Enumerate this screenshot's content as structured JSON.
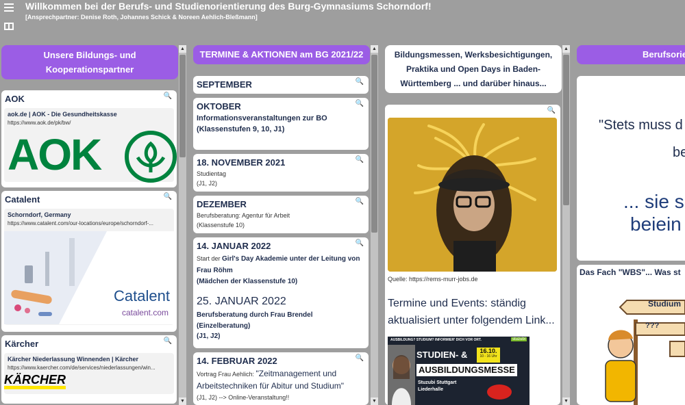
{
  "header": {
    "title": "Willkommen bei der Berufs- und Studienorientierung des Burg-Gymnasiums Schorndorf!",
    "subtitle": "[Ansprechpartner: Denise Roth, Johannes Schick & Noreen Aehlich-Bleßmann]"
  },
  "columns": {
    "col1": {
      "title": "Unsere Bildungs- und Kooperationspartner",
      "cards": [
        {
          "title": "AOK",
          "link_title": "aok.de | AOK - Die Gesundheitskasse",
          "link_url": "https://www.aok.de/pk/bw/"
        },
        {
          "title": "Catalent",
          "link_title": "Schorndorf, Germany",
          "link_url": "https://www.catalent.com/our-locations/europe/schorndorf-...",
          "logo_text": "Catalent",
          "logo_url": "catalent.com"
        },
        {
          "title": "Kärcher",
          "link_title": "Kärcher Niederlassung Winnenden | Kärcher",
          "link_url": "https://www.kaercher.com/de/services/niederlassungen/win...",
          "logo_text": "KÄRCHER"
        }
      ],
      "aok_logo": "AOK"
    },
    "col2": {
      "title": "TERMINE & AKTIONEN am BG 2021/22",
      "cards": {
        "sep": "SEPTEMBER",
        "okt_title": "OKTOBER",
        "okt_text": "Informationsveranstaltungen zur BO (Klassenstufen 9, 10, J1)",
        "nov_title": "18. NOVEMBER 2021",
        "nov_l1": "Studientag",
        "nov_l2": "(J1, J2)",
        "dez_title": "DEZEMBER",
        "dez_l1": "Berufsberatung: Agentur für Arbeit",
        "dez_l2": "(Klassenstufe 10)",
        "jan_title": "14. JANUAR 2022",
        "jan_pre": "Start der ",
        "jan_bold": "Girl's Day Akademie unter der Leitung von Frau Röhm",
        "jan_l2": "(Mädchen der Klassenstufe 10)",
        "jan25_title": "25. JANUAR 2022",
        "jan25_l1": "Berufsberatung durch Frau Brendel (Einzelberatung)",
        "jan25_l2": "(J1, J2)",
        "feb_title": "14. FEBRUAR 2022",
        "feb_pre": "Vortrag Frau Aehlich: ",
        "feb_big": "\"Zeitmanagement und Arbeitstechniken für Abitur und Studium\"",
        "feb_l2": "(J1, J2) -->  Online-Veranstaltung!!"
      }
    },
    "col3": {
      "title": "Bildungsmessen, Werksbesichtigungen, Praktika und Open Days in Baden-Württemberg ... und darüber hinaus...",
      "image_source": "Quelle: https://rems-murr-jobs.de",
      "events_text": "Termine und Events: ständig aktualisiert unter folgendem Link...",
      "ad_top": "AUSBILDUNG? STUDIUM? INFORMIER' DICH VOR ORT.",
      "ad_line1": "STUDIEN- &",
      "ad_line2": "AUSBILDUNGSMESSE",
      "ad_date": "16.10.",
      "ad_time": "10 - 16 Uhr",
      "ad_brand": "stuzubi",
      "ad_loc1": "Stuzubi Stuttgart",
      "ad_loc2": "Liederhalle"
    },
    "col4": {
      "title": "Berufsorie",
      "quote1": "\"Stets muss d",
      "quote2": "be",
      "quote3": "... sie s",
      "quote4": "beiein",
      "card2_title": "Das Fach \"WBS\"... Was st",
      "sign1": "Studium",
      "sign2": "???"
    }
  },
  "colors": {
    "accent": "#9b5de5",
    "background": "#9e9e9e",
    "text": "#1f2d4d",
    "aok_green": "#00833e"
  },
  "icons": {
    "search": "search-icon",
    "menu": "menu-icon",
    "board": "board-icon"
  }
}
